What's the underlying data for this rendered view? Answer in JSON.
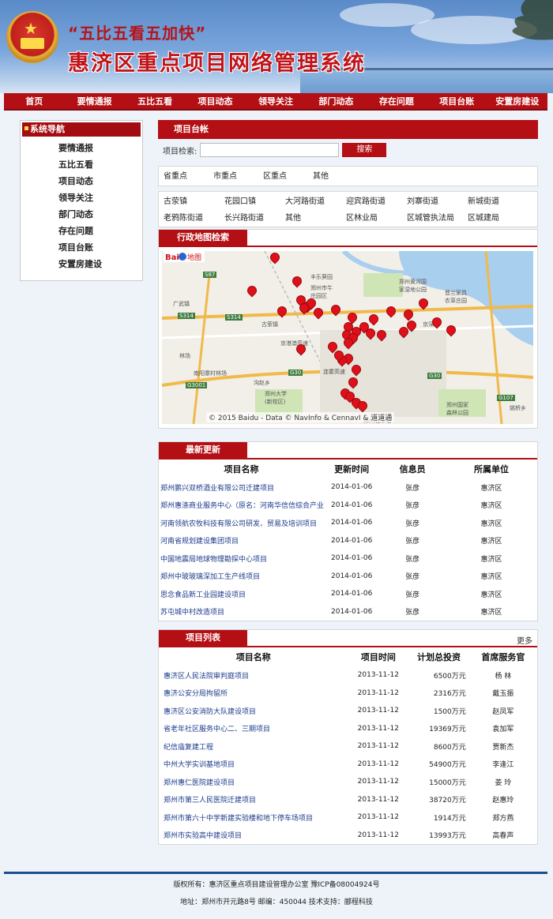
{
  "header": {
    "slogan": "“五比五看五加快”",
    "system_name": "惠济区重点项目网络管理系统"
  },
  "nav": [
    "首页",
    "要情通报",
    "五比五看",
    "项目动态",
    "领导关注",
    "部门动态",
    "存在问题",
    "项目台账",
    "安置房建设"
  ],
  "sidebar": {
    "title": "系统导航",
    "items": [
      "要情通报",
      "五比五看",
      "项目动态",
      "领导关注",
      "部门动态",
      "存在问题",
      "项目台账",
      "安置房建设"
    ]
  },
  "ledger": {
    "title": "项目台帐",
    "search_label": "项目检索:",
    "search_value": "",
    "search_button": "搜索",
    "levels": [
      "省重点",
      "市重点",
      "区重点",
      "其他"
    ],
    "units": [
      "古荥镇",
      "花园口镇",
      "大河路街道",
      "迎宾路街道",
      "刘寨街道",
      "新城街道",
      "老鸦陈街道",
      "长兴路街道",
      "其他",
      "区林业局",
      "区城管执法局",
      "区城建局"
    ]
  },
  "map": {
    "title": "行政地图检索",
    "labels": [
      "丰乐葵园",
      "郑州市牛\n庄园区",
      "郑州黄河国\n家湿地公园",
      "晋兰家具\n农草庄园",
      "广武镇",
      "S87",
      "S314",
      "S314",
      "古荥镇",
      "京港澳高速",
      "京深线",
      "连霍高速",
      "G30",
      "G30",
      "南阳寨村林场",
      "林场",
      "G3001",
      "沟赵乡",
      "郑州大学\n(新校区)",
      "郑州国家\n森林公园",
      "G107",
      "姚桥乡",
      "郑州北车站"
    ],
    "copyright": "© 2015 Baidu - Data © NavInfo & CennavI & 道道通"
  },
  "latest": {
    "title": "最新更新",
    "columns": [
      "项目名称",
      "更新时间",
      "信息员",
      "所属单位"
    ],
    "rows": [
      [
        "郑州鹏兴双桥酒业有限公司迁建项目",
        "2014-01-06",
        "张彦",
        "惠济区"
      ],
      [
        "郑州惠涤商业服务中心（原名：河南华信信综合产业",
        "2014-01-06",
        "张彦",
        "惠济区"
      ],
      [
        "河南领航农牧科技有限公司研发、贸易及培训项目",
        "2014-01-06",
        "张彦",
        "惠济区"
      ],
      [
        "河南省规划建设集团项目",
        "2014-01-06",
        "张彦",
        "惠济区"
      ],
      [
        "中国地震局地球物理勘探中心项目",
        "2014-01-06",
        "张彦",
        "惠济区"
      ],
      [
        "郑州中玻玻璃深加工生产线项目",
        "2014-01-06",
        "张彦",
        "惠济区"
      ],
      [
        "思念食品新工业园建设项目",
        "2014-01-06",
        "张彦",
        "惠济区"
      ],
      [
        "苏屯城中村改造项目",
        "2014-01-06",
        "张彦",
        "惠济区"
      ]
    ]
  },
  "projects": {
    "title": "项目列表",
    "more": "更多",
    "columns": [
      "项目名称",
      "项目时间",
      "计划总投资",
      "首席服务官"
    ],
    "rows": [
      [
        "惠济区人民法院审判庭项目",
        "2013-11-12",
        "6500万元",
        "杨 林"
      ],
      [
        "惠济公安分局拘留所",
        "2013-11-12",
        "2316万元",
        "戴玉振"
      ],
      [
        "惠济区公安消防大队建设项目",
        "2013-11-12",
        "1500万元",
        "赵凤军"
      ],
      [
        "省老年社区服务中心二、三期项目",
        "2013-11-12",
        "19369万元",
        "袁加军"
      ],
      [
        "纪信庙复建工程",
        "2013-11-12",
        "8600万元",
        "贾新杰"
      ],
      [
        "中州大学实训基地项目",
        "2013-11-12",
        "54900万元",
        "李逢江"
      ],
      [
        "郑州惠仁医院建设项目",
        "2013-11-12",
        "15000万元",
        "姜 玲"
      ],
      [
        "郑州市第三人民医院迁建项目",
        "2013-11-12",
        "38720万元",
        "赵惠玲"
      ],
      [
        "郑州市第六十中学新建实验楼和地下停车场项目",
        "2013-11-12",
        "1914万元",
        "郑方燕"
      ],
      [
        "郑州市实验高中建设项目",
        "2013-11-12",
        "13993万元",
        "高春声"
      ]
    ]
  },
  "footer": {
    "line1": "版权所有：惠济区重点项目建设管理办公室 豫ICP备08004924号",
    "line2": "地址：郑州市开元路8号 邮编：450044 技术支持：郦程科技"
  },
  "colors": {
    "brand_red": "#b30f14",
    "link_blue": "#1a3a8a",
    "footer_blue": "#1d4d8f"
  }
}
